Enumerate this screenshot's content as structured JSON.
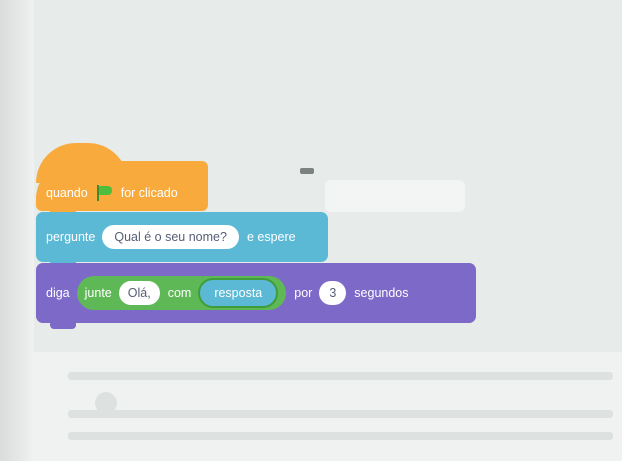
{
  "blocks": {
    "hat": {
      "prefix": "quando",
      "suffix": "for clicado",
      "icon": "green-flag-icon"
    },
    "ask": {
      "prefix": "pergunte",
      "question": "Qual é o seu nome?",
      "suffix": "e espere"
    },
    "say": {
      "prefix": "diga",
      "join_label": "junte",
      "join_text": "Olá,",
      "join_mid": "com",
      "join_var": "resposta",
      "for_label": "por",
      "seconds_value": "3",
      "seconds_label": "segundos"
    }
  },
  "colors": {
    "events": "#f9aa3d",
    "sensing": "#5cb9d6",
    "looks": "#7c69c8",
    "operators": "#5fb856"
  }
}
